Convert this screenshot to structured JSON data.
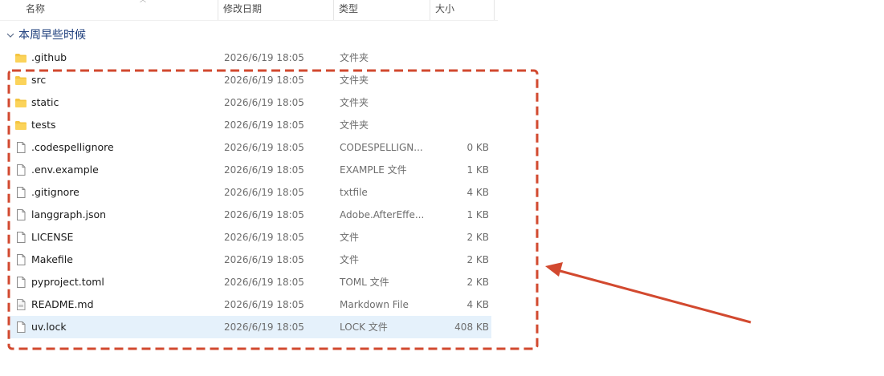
{
  "columns": {
    "name": "名称",
    "modified": "修改日期",
    "type": "类型",
    "size": "大小"
  },
  "group": {
    "label": "本周早些时候"
  },
  "files": [
    {
      "name": ".github",
      "date": "2026/6/19 18:05",
      "type": "文件夹",
      "size": "",
      "icon": "folder-icon"
    },
    {
      "name": "src",
      "date": "2026/6/19 18:05",
      "type": "文件夹",
      "size": "",
      "icon": "folder-icon"
    },
    {
      "name": "static",
      "date": "2026/6/19 18:05",
      "type": "文件夹",
      "size": "",
      "icon": "folder-icon"
    },
    {
      "name": "tests",
      "date": "2026/6/19 18:05",
      "type": "文件夹",
      "size": "",
      "icon": "folder-icon"
    },
    {
      "name": ".codespellignore",
      "date": "2026/6/19 18:05",
      "type": "CODESPELLIGN...",
      "size": "0 KB",
      "icon": "file-icon"
    },
    {
      "name": ".env.example",
      "date": "2026/6/19 18:05",
      "type": "EXAMPLE 文件",
      "size": "1 KB",
      "icon": "file-icon"
    },
    {
      "name": ".gitignore",
      "date": "2026/6/19 18:05",
      "type": "txtfile",
      "size": "4 KB",
      "icon": "file-icon"
    },
    {
      "name": "langgraph.json",
      "date": "2026/6/19 18:05",
      "type": "Adobe.AfterEffe...",
      "size": "1 KB",
      "icon": "file-icon"
    },
    {
      "name": "LICENSE",
      "date": "2026/6/19 18:05",
      "type": "文件",
      "size": "2 KB",
      "icon": "file-icon"
    },
    {
      "name": "Makefile",
      "date": "2026/6/19 18:05",
      "type": "文件",
      "size": "2 KB",
      "icon": "file-icon"
    },
    {
      "name": "pyproject.toml",
      "date": "2026/6/19 18:05",
      "type": "TOML 文件",
      "size": "2 KB",
      "icon": "file-icon"
    },
    {
      "name": "README.md",
      "date": "2026/6/19 18:05",
      "type": "Markdown File",
      "size": "4 KB",
      "icon": "markdown-file-icon"
    },
    {
      "name": "uv.lock",
      "date": "2026/6/19 18:05",
      "type": "LOCK 文件",
      "size": "408 KB",
      "icon": "file-icon",
      "selected": true
    }
  ],
  "colors": {
    "annotation": "#d2492f",
    "selection": "#e5f1fb",
    "folder": "#f4c542"
  }
}
